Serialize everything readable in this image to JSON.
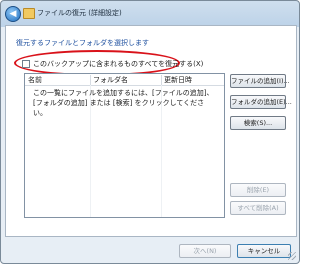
{
  "window": {
    "title": "ファイルの復元 (詳細設定)"
  },
  "instruction": "復元するファイルとフォルダを選択します",
  "restore_all_option": {
    "label": "このバックアップに含まれるものすべてを復元する(X)",
    "checked": false
  },
  "file_list": {
    "columns": [
      "名前",
      "フォルダ名",
      "更新日時"
    ],
    "empty_message": "この一覧にファイルを追加するには、[ファイルの追加]、[フォルダの追加] または [検索] をクリックしてください。"
  },
  "side_buttons": {
    "add_files": "ファイルの追加(I)...",
    "add_folders": "フォルダの追加(E)...",
    "search": "検索(S)...",
    "remove": "削除(E)",
    "remove_all": "すべて削除(A)"
  },
  "footer": {
    "next": "次へ(N)",
    "cancel": "キャンセル"
  },
  "colors": {
    "highlight": "#d9121a",
    "instruction_text": "#1c4e9e"
  }
}
